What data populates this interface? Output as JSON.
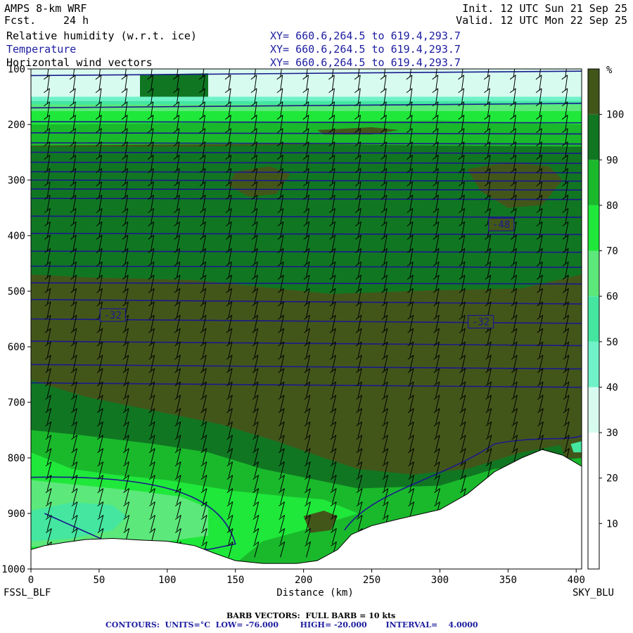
{
  "header": {
    "model": "AMPS 8-km WRF",
    "fcst_label": "Fcst.",
    "fcst_value": "24 h",
    "init": "Init. 12 UTC Sun 21 Sep 25",
    "valid": "Valid. 12 UTC Mon 22 Sep 25",
    "fields": [
      {
        "name": "Relative humidity (w.r.t. ice)",
        "xy": "XY= 660.6,264.5 to 619.4,293.7",
        "color": "#000000"
      },
      {
        "name": "Temperature",
        "xy": "XY= 660.6,264.5 to 619.4,293.7",
        "color": "#1c1ca0"
      },
      {
        "name": "Horizontal wind vectors",
        "xy": "XY= 660.6,264.5 to 619.4,293.7",
        "color": "#000000"
      }
    ]
  },
  "footer": {
    "barb": "BARB VECTORS:  FULL BARB = 10 kts",
    "contours": "CONTOURS:  UNITS=°C  LOW= -76.000        HIGH= -20.000       INTERVAL=    4.0000"
  },
  "chart_data": {
    "type": "heatmap",
    "title": "Relative humidity (w.r.t. ice), Temperature, Horizontal wind vectors",
    "xlabel": "Distance (km)",
    "ylabel": "",
    "x_ticks": [
      0,
      50,
      100,
      150,
      200,
      250,
      300,
      350,
      400
    ],
    "xlim": [
      0,
      404
    ],
    "y_ticks": [
      100,
      200,
      300,
      400,
      500,
      600,
      700,
      800,
      900,
      1000
    ],
    "ylim": [
      1000,
      100
    ],
    "x_left_label": "FSSL_BLF",
    "x_right_label": "SKY_BLU",
    "colorbar": {
      "unit": "%",
      "ticks": [
        10,
        20,
        30,
        40,
        50,
        60,
        70,
        80,
        90,
        100
      ],
      "bins": [
        {
          "from": 0,
          "to": 10,
          "color": "#ffffff"
        },
        {
          "from": 10,
          "to": 20,
          "color": "#ffffff"
        },
        {
          "from": 20,
          "to": 30,
          "color": "#ffffff"
        },
        {
          "from": 30,
          "to": 40,
          "color": "#d8fbf0"
        },
        {
          "from": 40,
          "to": 50,
          "color": "#6ff2c8"
        },
        {
          "from": 50,
          "to": 60,
          "color": "#44e6a0"
        },
        {
          "from": 60,
          "to": 70,
          "color": "#5ce87a"
        },
        {
          "from": 70,
          "to": 80,
          "color": "#1fe83a"
        },
        {
          "from": 80,
          "to": 90,
          "color": "#1ab92c"
        },
        {
          "from": 90,
          "to": 100,
          "color": "#117622"
        },
        {
          "from": 100,
          "to": 110,
          "color": "#43561a"
        }
      ]
    },
    "isotherms": [
      {
        "label": "-48",
        "x_km": 345,
        "p_hpa": 380
      },
      {
        "label": "-32",
        "x_km": 60,
        "p_hpa": 543
      },
      {
        "label": "-32",
        "x_km": 330,
        "p_hpa": 555
      }
    ],
    "terrain_surface": [
      {
        "x": 0,
        "p": 965
      },
      {
        "x": 10,
        "p": 958
      },
      {
        "x": 25,
        "p": 952
      },
      {
        "x": 40,
        "p": 947
      },
      {
        "x": 60,
        "p": 945
      },
      {
        "x": 80,
        "p": 948
      },
      {
        "x": 100,
        "p": 950
      },
      {
        "x": 120,
        "p": 958
      },
      {
        "x": 135,
        "p": 972
      },
      {
        "x": 150,
        "p": 985
      },
      {
        "x": 170,
        "p": 990
      },
      {
        "x": 195,
        "p": 990
      },
      {
        "x": 210,
        "p": 985
      },
      {
        "x": 225,
        "p": 965
      },
      {
        "x": 235,
        "p": 938
      },
      {
        "x": 250,
        "p": 922
      },
      {
        "x": 270,
        "p": 910
      },
      {
        "x": 300,
        "p": 893
      },
      {
        "x": 320,
        "p": 865
      },
      {
        "x": 340,
        "p": 825
      },
      {
        "x": 360,
        "p": 800
      },
      {
        "x": 375,
        "p": 785
      },
      {
        "x": 390,
        "p": 795
      },
      {
        "x": 404,
        "p": 815
      }
    ],
    "wind_barbs_note": "FULL BARB = 10 kts"
  }
}
